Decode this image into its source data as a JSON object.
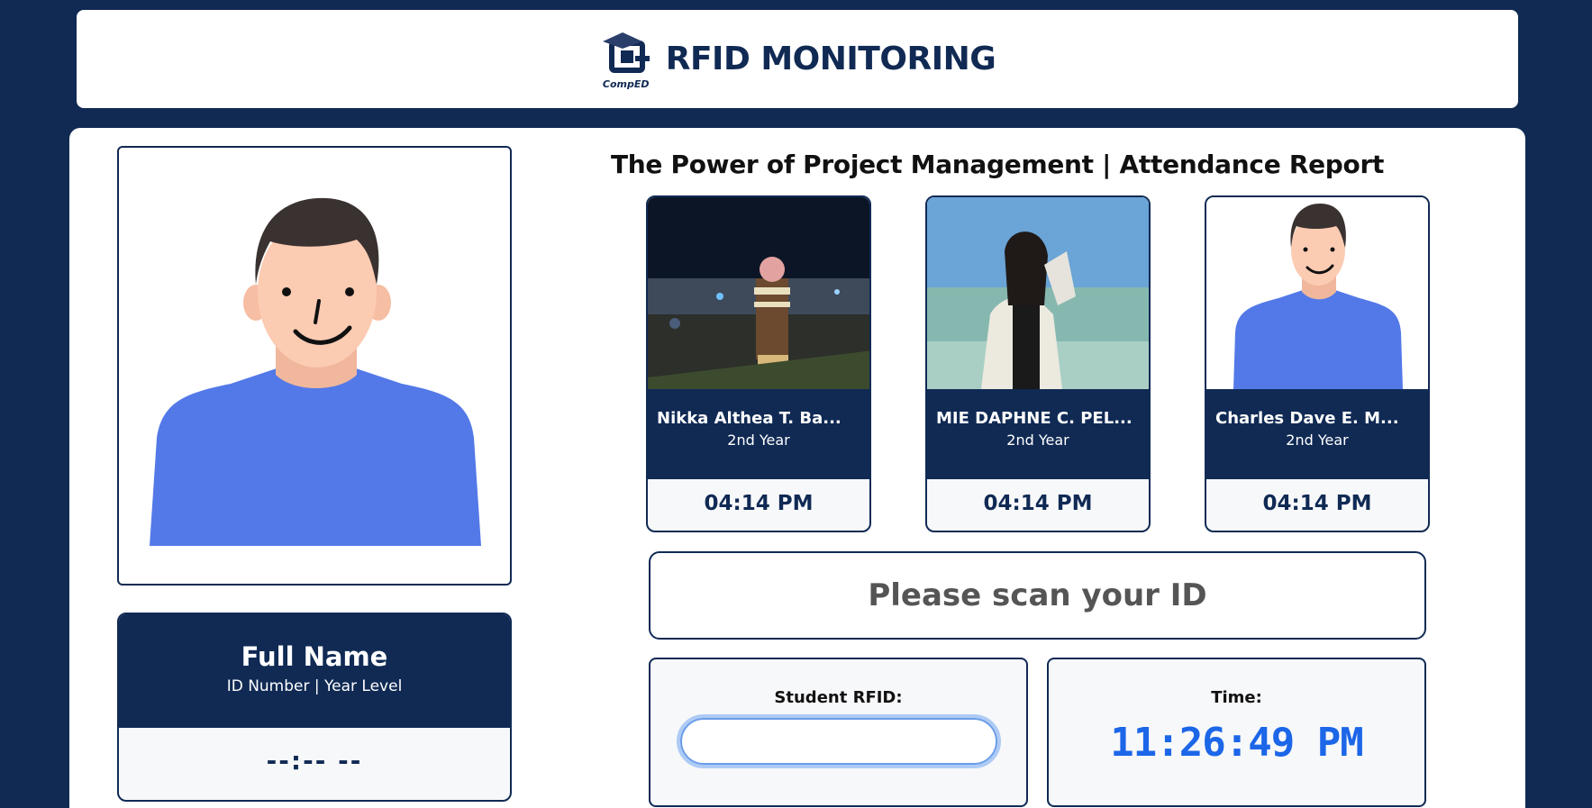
{
  "header": {
    "title": "RFID MONITORING",
    "logo_text": "CompED"
  },
  "profile": {
    "name": "Full Name",
    "subtitle": "ID Number | Year Level",
    "time": "--:-- --"
  },
  "report": {
    "title": "The Power of Project Management | Attendance Report",
    "attendees": [
      {
        "name": "Nikka Althea T. Ba...",
        "year": "2nd Year",
        "time": "04:14 PM",
        "photo": "night-beach-photo"
      },
      {
        "name": "MIE DAPHNE C. PEL...",
        "year": "2nd Year",
        "time": "04:14 PM",
        "photo": "beach-photo"
      },
      {
        "name": "Charles Dave E. M...",
        "year": "2nd Year",
        "time": "04:14 PM",
        "photo": "default-avatar"
      }
    ]
  },
  "scan": {
    "prompt": "Please scan your ID"
  },
  "rfid": {
    "label": "Student RFID:",
    "value": ""
  },
  "clock": {
    "label": "Time:",
    "value": "11:26:49 PM"
  },
  "colors": {
    "navy": "#102a54",
    "shirt": "#5379e8",
    "skin": "#fbcbb2",
    "clock": "#1c66e8"
  }
}
